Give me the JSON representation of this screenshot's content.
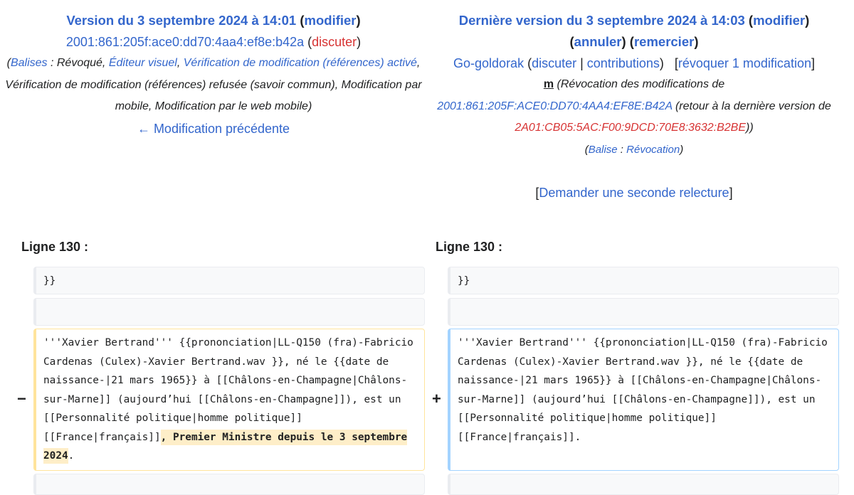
{
  "left": {
    "title_prefix": "Version du 3 septembre 2024 à 14:01",
    "modify": "modifier",
    "user": "2001:861:205f:ace0:dd70:4aa4:ef8e:b42a",
    "talk": "discuter",
    "tags_label": "Balises",
    "tags": [
      "Révoqué",
      "Éditeur visuel",
      "Vérification de modification (références) activé",
      "Vérification de modification (références) refusée (savoir commun)",
      "Modification par mobile",
      "Modification par le web mobile"
    ],
    "prev_link": "← Modification précédente",
    "line_header": "Ligne 130 :"
  },
  "right": {
    "title_prefix": "Dernière version du 3 septembre 2024 à 14:03",
    "modify": "modifier",
    "undo": "annuler",
    "thank": "remercier",
    "user": "Go-goldorak",
    "talk": "discuter",
    "contribs": "contributions",
    "rollback": "révoquer 1 modification",
    "minor": "m",
    "summary_pre": "(Révocation des modifications de",
    "summary_ip": "2001:861:205F:ACE0:DD70:4AA4:EF8E:B42A",
    "summary_mid": "(retour à la dernière version de",
    "summary_ip2": "2A01:CB05:5AC:F00:9DCD:70E8:3632:B2BE",
    "summary_post": "))",
    "tag_label": "Balise",
    "tag": "Révocation",
    "second_review": "Demander une seconde relecture",
    "line_header": "Ligne 130 :"
  },
  "diff": {
    "context1": "}}",
    "context2": "",
    "common_text": "'''Xavier Bertrand''' {{prononciation|LL-Q150 (fra)-Fabricio Cardenas (Culex)-Xavier Bertrand.wav }}, né le {{date de naissance-|21 mars 1965}} à [[Châlons-en-Champagne|Châlons-sur-Marne]] (aujourd’hui [[Châlons-en-Champagne]]), est un [[Personnalité politique|homme politique]] [[France|français]]",
    "deleted_part": ", Premier Ministre depuis le 3 septembre 2024",
    "end_dot": ".",
    "minus": "−",
    "plus": "+"
  }
}
